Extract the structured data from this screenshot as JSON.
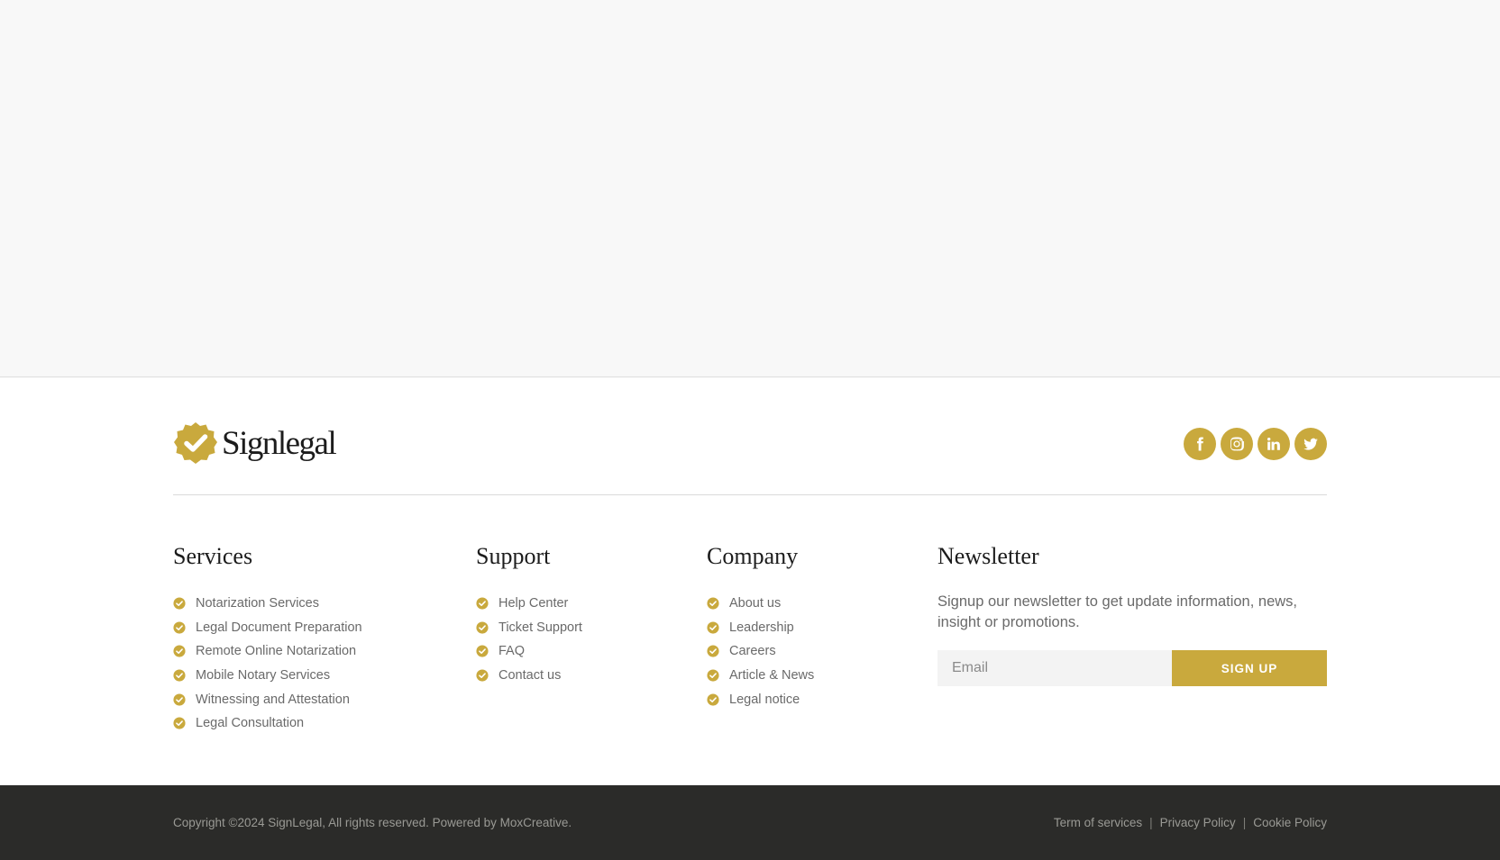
{
  "brand": {
    "name": "Signlegal",
    "accent_color": "#c9a93d",
    "dark_color": "#2b2b29"
  },
  "socials": [
    {
      "name": "facebook",
      "icon": "facebook-icon"
    },
    {
      "name": "instagram",
      "icon": "instagram-icon"
    },
    {
      "name": "linkedin",
      "icon": "linkedin-icon"
    },
    {
      "name": "twitter",
      "icon": "twitter-icon"
    }
  ],
  "columns": {
    "services": {
      "title": "Services",
      "items": [
        "Notarization Services",
        "Legal Document Preparation",
        "Remote Online Notarization",
        "Mobile Notary Services",
        "Witnessing and Attestation",
        "Legal Consultation"
      ]
    },
    "support": {
      "title": "Support",
      "items": [
        "Help Center",
        "Ticket Support",
        "FAQ",
        "Contact us"
      ]
    },
    "company": {
      "title": "Company",
      "items": [
        "About us",
        "Leadership",
        "Careers",
        "Article & News",
        "Legal notice"
      ]
    }
  },
  "newsletter": {
    "title": "Newsletter",
    "description": "Signup our newsletter to get update information, news, insight or promotions.",
    "email_placeholder": "Email",
    "email_value": "",
    "button_label": "SIGN UP"
  },
  "bottom": {
    "copyright": "Copyright ©2024 SignLegal, All rights reserved. Powered by MoxCreative.",
    "links": [
      "Term of services",
      "Privacy Policy",
      "Cookie Policy"
    ],
    "separator": "|"
  }
}
